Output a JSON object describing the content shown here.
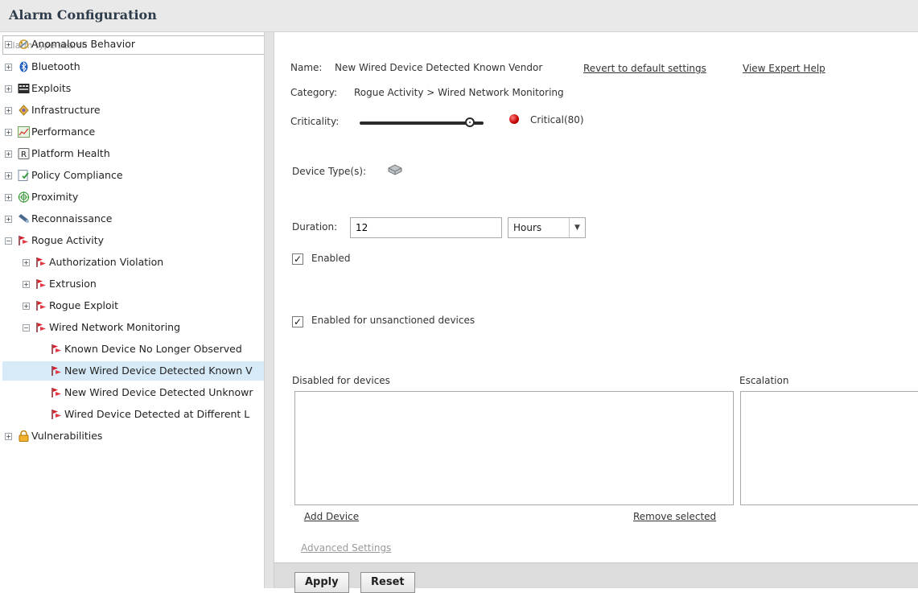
{
  "window": {
    "title": "Alarm Configuration"
  },
  "sidebar": {
    "search_placeholder": "Alarm type search",
    "tree": [
      {
        "label": "Anomalous Behavior",
        "icon": "anomalous-behavior-icon",
        "expander": "+"
      },
      {
        "label": "Bluetooth",
        "icon": "bluetooth-icon",
        "expander": "+"
      },
      {
        "label": "Exploits",
        "icon": "exploits-icon",
        "expander": "+"
      },
      {
        "label": "Infrastructure",
        "icon": "infrastructure-icon",
        "expander": "+"
      },
      {
        "label": "Performance",
        "icon": "performance-chart-icon",
        "expander": "+"
      },
      {
        "label": "Platform Health",
        "icon": "platform-health-icon",
        "expander": "+"
      },
      {
        "label": "Policy Compliance",
        "icon": "policy-compliance-icon",
        "expander": "+"
      },
      {
        "label": "Proximity",
        "icon": "proximity-icon",
        "expander": "+"
      },
      {
        "label": "Reconnaissance",
        "icon": "reconnaissance-icon",
        "expander": "+"
      },
      {
        "label": "Rogue Activity",
        "icon": "rogue-flag-icon",
        "expander": "−"
      },
      {
        "label": "Authorization Violation",
        "icon": "rogue-flag-icon",
        "expander": "+"
      },
      {
        "label": "Extrusion",
        "icon": "rogue-flag-icon",
        "expander": "+"
      },
      {
        "label": "Rogue Exploit",
        "icon": "rogue-flag-icon",
        "expander": "+"
      },
      {
        "label": "Wired Network Monitoring",
        "icon": "rogue-flag-icon",
        "expander": "−"
      },
      {
        "label": "Known Device No Longer Observed",
        "icon": "rogue-flag-icon",
        "expander": ""
      },
      {
        "label": "New Wired Device Detected Known V",
        "icon": "rogue-flag-icon",
        "expander": "",
        "selected": true
      },
      {
        "label": "New Wired Device Detected Unknowr",
        "icon": "rogue-flag-icon",
        "expander": ""
      },
      {
        "label": "Wired Device Detected at Different L",
        "icon": "rogue-flag-icon",
        "expander": ""
      },
      {
        "label": "Vulnerabilities",
        "icon": "vulnerabilities-lock-icon",
        "expander": "+"
      }
    ]
  },
  "detail": {
    "name_key": "Name:",
    "name_value": "New Wired Device Detected Known Vendor",
    "revert_link": "Revert to default settings",
    "help_link": "View Expert Help",
    "category_key": "Category:",
    "category_value": "Rogue Activity > Wired Network Monitoring",
    "criticality_key": "Criticality:",
    "criticality_value": "Critical(80)",
    "criticality_level": 80,
    "criticality_color": "#d40000",
    "device_types_key": "Device Type(s):",
    "device_type_icon": "wired-device-icon",
    "duration_key": "Duration:",
    "duration_value": "12",
    "duration_unit": "Hours",
    "enabled_label": "Enabled",
    "enabled_checked": true,
    "unsanctioned_label": "Enabled for unsanctioned devices",
    "unsanctioned_checked": true,
    "disabled_devices_header": "Disabled for devices",
    "escalation_header": "Escalation",
    "add_device_link": "Add Device",
    "remove_selected_link": "Remove selected",
    "advanced_settings_link": "Advanced Settings"
  },
  "buttons": {
    "apply": "Apply",
    "reset": "Reset"
  },
  "colors": {
    "selection": "#d7eaf8",
    "rogue_flag": "#d91e2a"
  }
}
